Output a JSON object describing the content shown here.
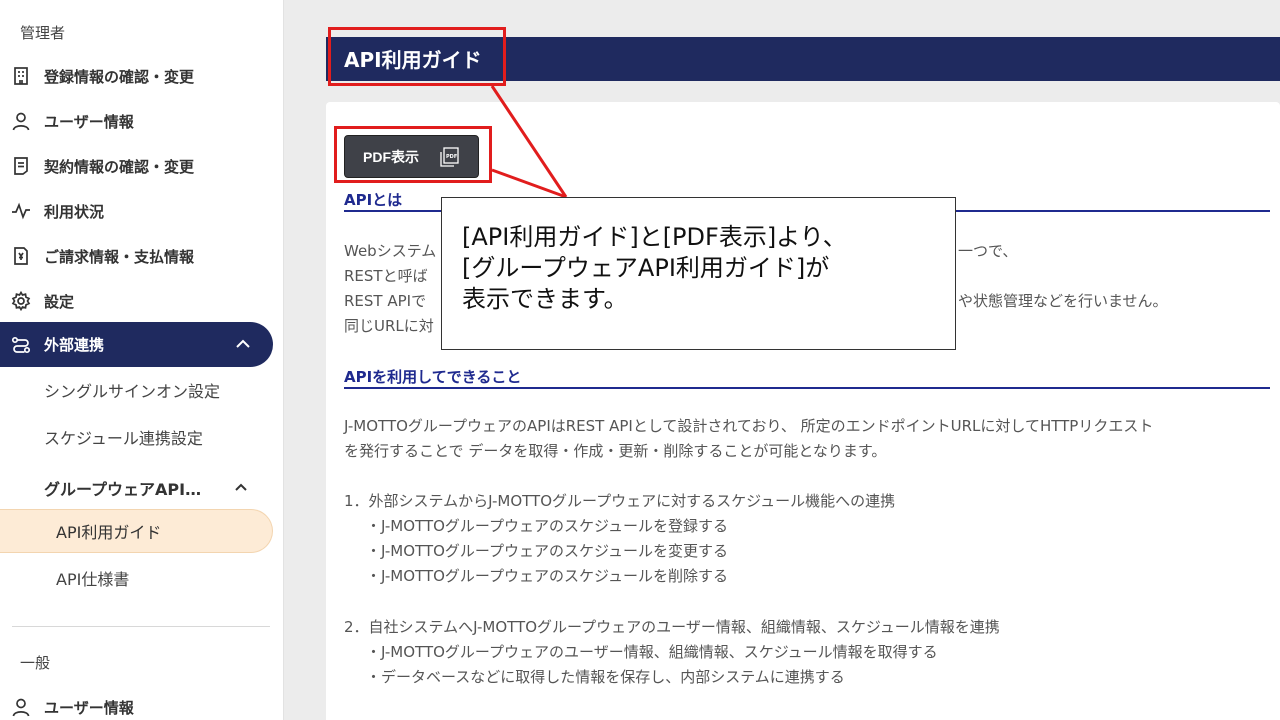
{
  "sidebar": {
    "section_admin": "管理者",
    "items": [
      {
        "label": "登録情報の確認・変更",
        "icon": "building-icon"
      },
      {
        "label": "ユーザー情報",
        "icon": "user-icon"
      },
      {
        "label": "契約情報の確認・変更",
        "icon": "document-icon"
      },
      {
        "label": "利用状況",
        "icon": "activity-icon"
      },
      {
        "label": "ご請求情報・支払情報",
        "icon": "invoice-icon"
      },
      {
        "label": "設定",
        "icon": "gear-icon"
      }
    ],
    "active_item": {
      "label": "外部連携",
      "icon": "integration-icon"
    },
    "sub_items": [
      "シングルサインオン設定",
      "スケジュール連携設定"
    ],
    "sub_group": "グループウェアAPI…",
    "subsub_active": "API利用ガイド",
    "subsub_item": "API仕様書",
    "section_general": "一般",
    "general_items": [
      {
        "label": "ユーザー情報",
        "icon": "user-icon"
      }
    ]
  },
  "main": {
    "title": "API利用ガイド",
    "pdf_button_label": "PDF表示",
    "section1": {
      "heading": "APIとは",
      "lines": [
        "Webシステム",
        "RESTと呼ば",
        "REST APIで",
        "同じURLに対"
      ],
      "line_right_1": "一つで、",
      "line_right_3": "や状態管理などを行いません。"
    },
    "section2": {
      "heading": "APIを利用してできること",
      "paragraph": [
        "J-MOTTOグループウェアのAPIはREST APIとして設計されており、 所定のエンドポイントURLに対してHTTPリクエスト",
        "を発行することで データを取得・作成・更新・削除することが可能となります。"
      ],
      "list1_title": "1．外部システムからJ-MOTTOグループウェアに対するスケジュール機能への連携",
      "list1_items": [
        "・J-MOTTOグループウェアのスケジュールを登録する",
        "・J-MOTTOグループウェアのスケジュールを変更する",
        "・J-MOTTOグループウェアのスケジュールを削除する"
      ],
      "list2_title": "2．自社システムへJ-MOTTOグループウェアのユーザー情報、組織情報、スケジュール情報を連携",
      "list2_items": [
        "・J-MOTTOグループウェアのユーザー情報、組織情報、スケジュール情報を取得する",
        "・データベースなどに取得した情報を保存し、内部システムに連携する"
      ]
    }
  },
  "callout": {
    "lines": [
      "[API利用ガイド]と[PDF表示]より、",
      "[グループウェアAPI利用ガイド]が",
      "表示できます。"
    ]
  },
  "colors": {
    "navy": "#1f2a5f",
    "annotation_red": "#e11d1d",
    "active_sub_bg": "#fdebd6",
    "heading_blue": "#1f2a8f"
  }
}
